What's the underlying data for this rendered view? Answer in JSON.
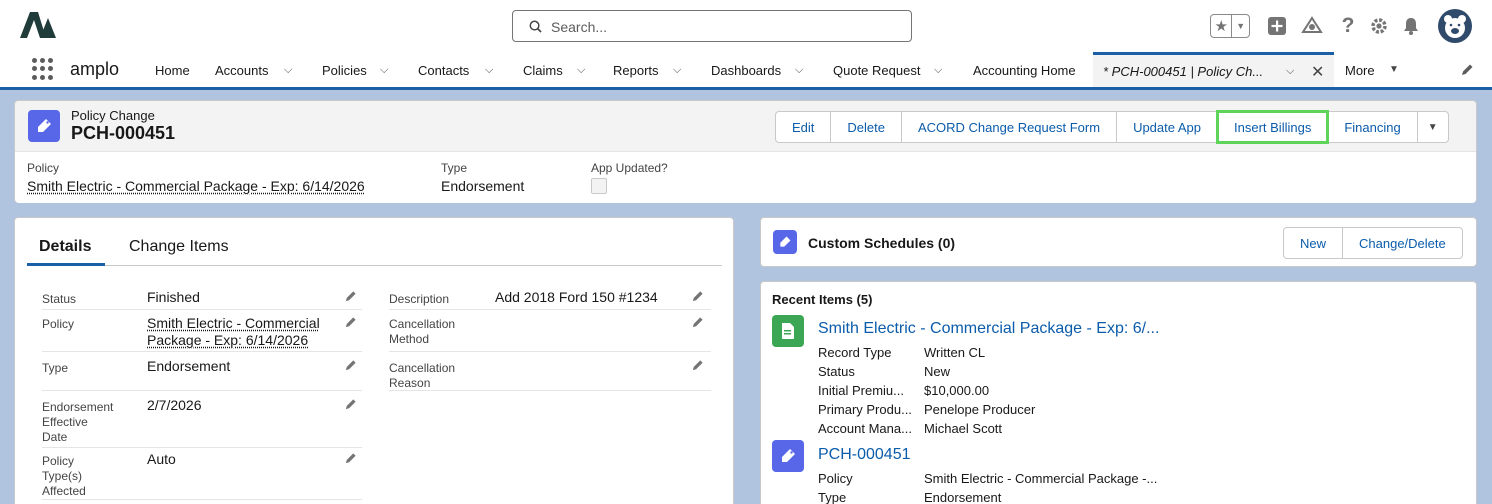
{
  "header": {
    "search_placeholder": "Search...",
    "icons": [
      "favorites-star-icon",
      "add-icon",
      "trailhead-icon",
      "help-icon",
      "setup-gear-icon",
      "notifications-bell-icon",
      "user-avatar"
    ]
  },
  "nav": {
    "app_name": "amplo",
    "items": [
      {
        "label": "Home",
        "has_menu": false
      },
      {
        "label": "Accounts",
        "has_menu": true
      },
      {
        "label": "Policies",
        "has_menu": true
      },
      {
        "label": "Contacts",
        "has_menu": true
      },
      {
        "label": "Claims",
        "has_menu": true
      },
      {
        "label": "Reports",
        "has_menu": true
      },
      {
        "label": "Dashboards",
        "has_menu": true
      },
      {
        "label": "Quote Request",
        "has_menu": true
      },
      {
        "label": "Accounting Home",
        "has_menu": false
      }
    ],
    "active_tab": "* PCH-000451 | Policy Ch...",
    "more_label": "More"
  },
  "record": {
    "object_label": "Policy Change",
    "name": "PCH-000451",
    "buttons": [
      "Edit",
      "Delete",
      "ACORD Change Request Form",
      "Update App",
      "Insert Billings",
      "Financing"
    ],
    "highlighted_button": "Insert Billings",
    "highlights": {
      "policy_label": "Policy",
      "policy_value": "Smith Electric - Commercial Package - Exp: 6/14/2026",
      "type_label": "Type",
      "type_value": "Endorsement",
      "app_updated_label": "App Updated?",
      "app_updated_checked": false
    }
  },
  "details": {
    "tabs": [
      "Details",
      "Change Items"
    ],
    "left": {
      "status_label": "Status",
      "status_value": "Finished",
      "policy_label": "Policy",
      "policy_value_line1": "Smith Electric - Commercial",
      "policy_value_line2": "Package - Exp: 6/14/2026",
      "type_label": "Type",
      "type_value": "Endorsement",
      "endorsement_label_1": "Endorsement",
      "endorsement_label_2": "Effective",
      "endorsement_label_3": "Date",
      "endorsement_value": "2/7/2026",
      "ptype_label_1": "Policy",
      "ptype_label_2": "Type(s)",
      "ptype_label_3": "Affected",
      "ptype_value": "Auto"
    },
    "right": {
      "description_label": "Description",
      "description_value": "Add 2018 Ford 150 #1234",
      "cancel_method_label_1": "Cancellation",
      "cancel_method_label_2": "Method",
      "cancel_reason_label_1": "Cancellation",
      "cancel_reason_label_2": "Reason"
    }
  },
  "custom_schedules": {
    "title": "Custom Schedules (0)",
    "buttons": [
      "New",
      "Change/Delete"
    ]
  },
  "recent_items": {
    "title": "Recent Items (5)",
    "items": [
      {
        "title": "Smith Electric - Commercial Package - Exp: 6/...",
        "icon": "policy-document-icon",
        "fields": [
          {
            "label": "Record Type",
            "value": "Written CL"
          },
          {
            "label": "Status",
            "value": "New"
          },
          {
            "label": "Initial Premiu...",
            "value": "$10,000.00"
          },
          {
            "label": "Primary Produ...",
            "value": "Penelope Producer"
          },
          {
            "label": "Account Mana...",
            "value": "Michael Scott"
          }
        ]
      },
      {
        "title": "PCH-000451",
        "icon": "policy-change-icon",
        "fields": [
          {
            "label": "Policy",
            "value": "Smith Electric - Commercial Package -..."
          },
          {
            "label": "Type",
            "value": "Endorsement"
          }
        ]
      }
    ]
  },
  "colors": {
    "brand_blue": "#0b5cab",
    "object_icon": "#5867e8",
    "recent_policy_icon": "#3ba755",
    "highlight_outline": "#5ed45a"
  }
}
